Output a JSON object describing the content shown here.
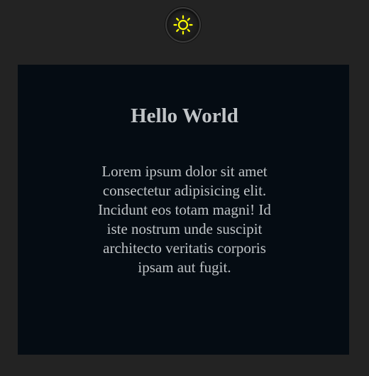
{
  "theme_toggle": {
    "icon": "sun-icon",
    "icon_color": "#ffff00"
  },
  "card": {
    "title": "Hello World",
    "body": "Lorem ipsum dolor sit amet consectetur adipisicing elit. Incidunt eos totam magni! Id iste nostrum unde suscipit architecto veritatis corporis ipsam aut fugit."
  },
  "colors": {
    "page_background": "#232323",
    "card_background": "#050c13",
    "text": "#c0c4c7"
  }
}
